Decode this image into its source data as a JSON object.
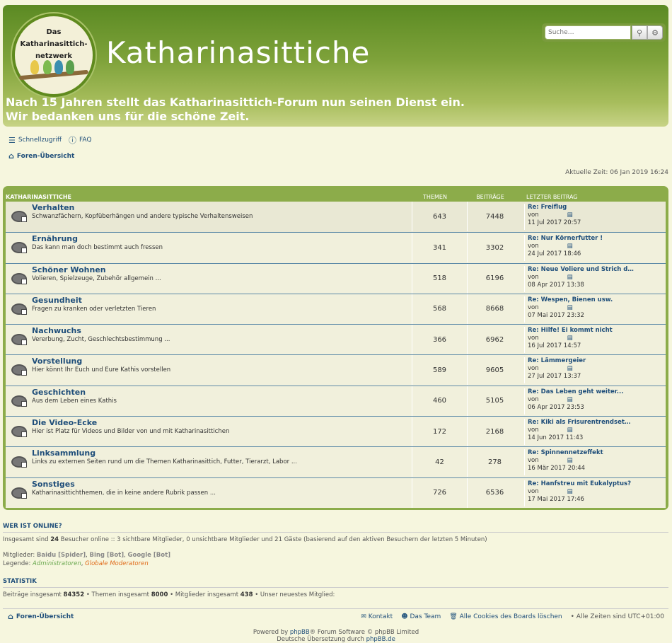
{
  "header": {
    "logo_text": "Das\nKatharinasittich-\nnetzwerk",
    "site_title": "Katharinasittiche",
    "banner_line1": "Nach 15 Jahren stellt das Katharinasittich-Forum nun seinen Dienst ein.",
    "banner_line2": "Wir bedanken uns für die schöne Zeit.",
    "search_placeholder": "Suche…"
  },
  "nav": {
    "quicklinks": "Schnellzugriff",
    "faq": "FAQ",
    "breadcrumb": "Foren-Übersicht",
    "current_time": "Aktuelle Zeit: 06 Jan 2019 16:24"
  },
  "forum": {
    "category": "KATHARINASITTICHE",
    "col_topics": "THEMEN",
    "col_posts": "BEITRÄGE",
    "col_last": "LETZTER BEITRAG",
    "rows": [
      {
        "title": "Verhalten",
        "desc": "Schwanzfächern, Kopfüberhängen und andere typische Verhaltensweisen",
        "topics": "643",
        "posts": "7448",
        "last_title": "Re: Freiflug",
        "last_by": "von",
        "last_date": "11 Jul 2017 20:57"
      },
      {
        "title": "Ernährung",
        "desc": "Das kann man doch bestimmt auch fressen",
        "topics": "341",
        "posts": "3302",
        "last_title": "Re: Nur Körnerfutter !",
        "last_by": "von",
        "last_date": "24 Jul 2017 18:46"
      },
      {
        "title": "Schöner Wohnen",
        "desc": "Volieren, Spielzeuge, Zubehör allgemein ...",
        "topics": "518",
        "posts": "6196",
        "last_title": "Re: Neue Voliere und Strich d…",
        "last_by": "von",
        "last_date": "08 Apr 2017 13:38"
      },
      {
        "title": "Gesundheit",
        "desc": "Fragen zu kranken oder verletzten Tieren",
        "topics": "568",
        "posts": "8668",
        "last_title": "Re: Wespen, Bienen usw.",
        "last_by": "von",
        "last_date": "07 Mai 2017 23:32"
      },
      {
        "title": "Nachwuchs",
        "desc": "Vererbung, Zucht, Geschlechtsbestimmung ...",
        "topics": "366",
        "posts": "6962",
        "last_title": "Re: Hilfe! Ei kommt nicht",
        "last_by": "von",
        "last_date": "16 Jul 2017 14:57"
      },
      {
        "title": "Vorstellung",
        "desc": "Hier könnt Ihr Euch und Eure Kathis vorstellen",
        "topics": "589",
        "posts": "9605",
        "last_title": "Re: Lämmergeier",
        "last_by": "von",
        "last_date": "27 Jul 2017 13:37"
      },
      {
        "title": "Geschichten",
        "desc": "Aus dem Leben eines Kathis",
        "topics": "460",
        "posts": "5105",
        "last_title": "Re: Das Leben geht weiter...",
        "last_by": "von",
        "last_date": "06 Apr 2017 23:53"
      },
      {
        "title": "Die Video-Ecke",
        "desc": "Hier ist Platz für Videos und Bilder von und mit Katharinasittichen",
        "topics": "172",
        "posts": "2168",
        "last_title": "Re: Kiki als Frisurentrendset…",
        "last_by": "von",
        "last_date": "14 Jun 2017 11:43"
      },
      {
        "title": "Linksammlung",
        "desc": "Links zu externen Seiten rund um die Themen Katharinasittich, Futter, Tierarzt, Labor ...",
        "topics": "42",
        "posts": "278",
        "last_title": "Re: Spinnennetzeffekt",
        "last_by": "von",
        "last_date": "16 Mär 2017 20:44"
      },
      {
        "title": "Sonstiges",
        "desc": "Katharinasittichthemen, die in keine andere Rubrik passen ...",
        "topics": "726",
        "posts": "6536",
        "last_title": "Re: Hanfstreu mit Eukalyptus?",
        "last_by": "von",
        "last_date": "17 Mai 2017 17:46"
      }
    ]
  },
  "online": {
    "heading": "WER IST ONLINE?",
    "text_pre": "Insgesamt sind ",
    "count": "24",
    "text_post": " Besucher online :: 3 sichtbare Mitglieder, 0 unsichtbare Mitglieder und 21 Gäste (basierend auf den aktiven Besuchern der letzten 5 Minuten)",
    "members_label": "Mitglieder: ",
    "members": [
      "Baidu [Spider]",
      "Bing [Bot]",
      "Google [Bot]"
    ],
    "legend_label": "Legende: ",
    "legend_admin": "Administratoren",
    "legend_gmod": "Globale Moderatoren"
  },
  "stats": {
    "heading": "STATISTIK",
    "posts_label": "Beiträge insgesamt ",
    "posts": "84352",
    "topics_label": " • Themen insgesamt ",
    "topics": "8000",
    "members_label": " • Mitglieder insgesamt ",
    "members": "438",
    "newest_label": " • Unser neuestes Mitglied:"
  },
  "footer": {
    "breadcrumb": "Foren-Übersicht",
    "contact": "Kontakt",
    "team": "Das Team",
    "cookies": "Alle Cookies des Boards löschen",
    "timezone": "• Alle Zeiten sind UTC+01:00",
    "powered_pre": "Powered by ",
    "phpbb": "phpBB",
    "powered_post": "® Forum Software © phpBB Limited",
    "german_pre": "Deutsche Übersetzung durch ",
    "phpbbde": "phpBB.de"
  },
  "colors": {
    "header_green": "#7ea23a",
    "link_blue": "#1f4e7a",
    "page_bg": "#f6f6de"
  }
}
